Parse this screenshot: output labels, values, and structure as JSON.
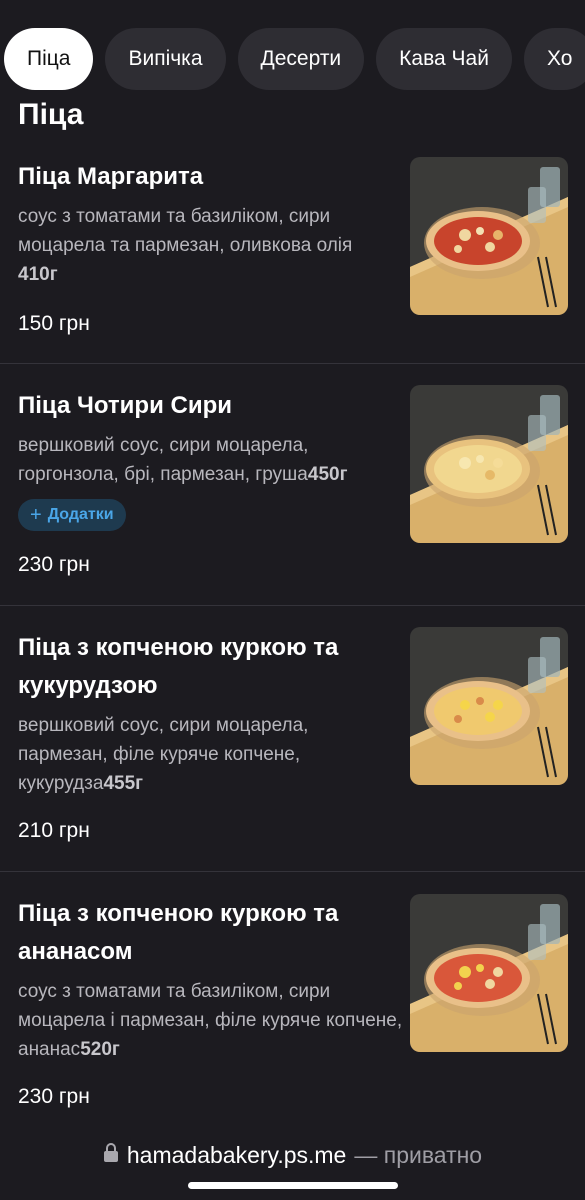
{
  "tabs": [
    {
      "label": "Піца",
      "active": true
    },
    {
      "label": "Випічка",
      "active": false
    },
    {
      "label": "Десерти",
      "active": false
    },
    {
      "label": "Кава Чай",
      "active": false
    },
    {
      "label": "Хо",
      "active": false
    }
  ],
  "section_title": "Піца",
  "items": [
    {
      "name": "Піца Маргарита",
      "description": "соус з томатами та базиліком, сири моцарела та пармезан, оливкова олія",
      "weight": "410г",
      "price": "150 грн",
      "image_icon": "pizza-margarita-photo"
    },
    {
      "name": "Піца Чотири Сири",
      "description": "вершковий соус, сири моцарела, горгонзола, брі, пармезан, груша",
      "weight": "450г",
      "addons_label": "Додатки",
      "price": "230 грн",
      "image_icon": "pizza-four-cheese-photo"
    },
    {
      "name": "Піца з копченою куркою та кукурудзою",
      "description": "вершковий соус, сири моцарела, пармезан, філе куряче копчене, кукурудза",
      "weight": "455г",
      "price": "210 грн",
      "image_icon": "pizza-chicken-corn-photo"
    },
    {
      "name": "Піца з копченою куркою та ананасом",
      "description": "соус з томатами та базиліком, сири моцарела і пармезан, філе куряче копчене, ананас",
      "weight": "520г",
      "price": "230 грн",
      "image_icon": "pizza-chicken-pineapple-photo"
    }
  ],
  "footer": {
    "url": "hamadabakery.ps.me",
    "privacy": "— приватно",
    "lock_icon": "lock-icon"
  }
}
